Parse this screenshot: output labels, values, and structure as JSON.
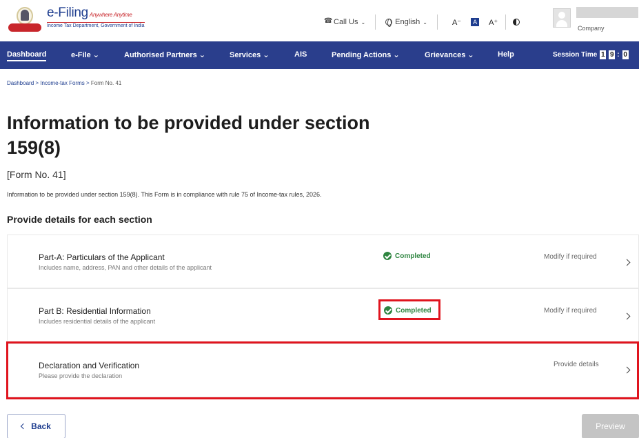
{
  "header": {
    "logo_title": "e-Filing",
    "logo_tagline": "Anywhere Anytime",
    "logo_subtitle": "Income Tax Department, Government of India",
    "call_us": "Call Us",
    "language": "English",
    "font_decrease": "A⁻",
    "font_normal": "A",
    "font_increase": "A⁺",
    "user_company": "Company"
  },
  "nav": {
    "items": [
      "Dashboard",
      "e-File ⌄",
      "Authorised Partners ⌄",
      "Services ⌄",
      "AIS",
      "Pending Actions ⌄",
      "Grievances ⌄",
      "Help"
    ],
    "session_label": "Session Time",
    "session_digits": [
      "1",
      "9",
      ":",
      "0"
    ]
  },
  "breadcrumb": {
    "items": [
      "Dashboard",
      "Income-tax Forms",
      "Form No. 41"
    ],
    "separator": ">"
  },
  "page": {
    "title": "Information to be provided under section 159(8)",
    "form_no": "[Form No. 41]",
    "description": "Information to be provided under section 159(8). This Form is in compliance with rule 75 of Income-tax rules, 2026.",
    "section_heading": "Provide details for each section"
  },
  "sections": [
    {
      "title": "Part-A: Particulars of the Applicant",
      "desc": "Includes name, address, PAN and other details of the applicant",
      "status": "Completed",
      "action": "Modify if required"
    },
    {
      "title": "Part B: Residential Information",
      "desc": "Includes residential details of the applicant",
      "status": "Completed",
      "action": "Modify if required"
    },
    {
      "title": "Declaration and Verification",
      "desc": "Please provide the declaration",
      "status": "",
      "action": "Provide details"
    }
  ],
  "footer": {
    "back_label": "Back",
    "preview_label": "Preview"
  },
  "colors": {
    "nav_bg": "#2a3e8c",
    "brand_blue": "#1e3d8f",
    "success": "#2e8540",
    "highlight": "#e0141e",
    "disabled": "#c4c4c4"
  }
}
